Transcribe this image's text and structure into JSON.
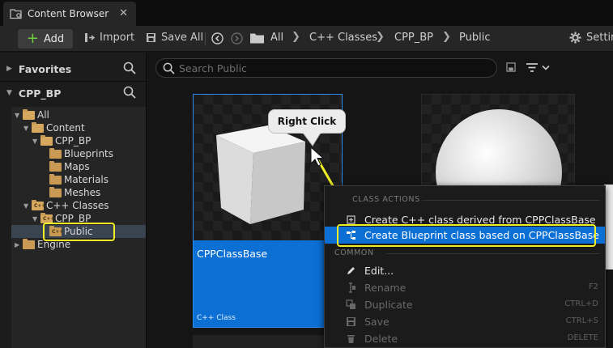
{
  "tab": {
    "title": "Content Browser",
    "close": "✕"
  },
  "toolbar": {
    "add_label": "Add",
    "add_plus": "+",
    "import_label": "Import",
    "save_all_label": "Save All",
    "settings_label": "Settings"
  },
  "breadcrumb": [
    "All",
    "C++ Classes",
    "CPP_BP",
    "Public"
  ],
  "left": {
    "favorites_label": "Favorites",
    "project_label": "CPP_BP",
    "tree": [
      {
        "label": "All",
        "depth": 0,
        "open": true,
        "cpp": false
      },
      {
        "label": "Content",
        "depth": 1,
        "open": true,
        "cpp": false
      },
      {
        "label": "CPP_BP",
        "depth": 2,
        "open": true,
        "cpp": false
      },
      {
        "label": "Blueprints",
        "depth": 3,
        "open": false,
        "cpp": false
      },
      {
        "label": "Maps",
        "depth": 3,
        "open": false,
        "cpp": false
      },
      {
        "label": "Materials",
        "depth": 3,
        "open": false,
        "cpp": false
      },
      {
        "label": "Meshes",
        "depth": 3,
        "open": false,
        "cpp": false
      },
      {
        "label": "C++ Classes",
        "depth": 1,
        "open": true,
        "cpp": true
      },
      {
        "label": "CPP_BP",
        "depth": 2,
        "open": true,
        "cpp": true
      },
      {
        "label": "Public",
        "depth": 3,
        "open": false,
        "cpp": true
      },
      {
        "label": "Engine",
        "depth": 0,
        "open": false,
        "cpp": false
      }
    ]
  },
  "search": {
    "placeholder": "Search Public"
  },
  "asset": {
    "name": "CPPClassBase",
    "type": "C++ Class"
  },
  "callout": {
    "text": "Right Click"
  },
  "menu": {
    "category_class_actions": "CLASS ACTIONS",
    "category_common": "COMMON",
    "items": [
      {
        "label": "Create C++ class derived from CPPClassBase",
        "shortcut": "",
        "enabled": true,
        "highlighted": false,
        "icon": "cpp-class-icon"
      },
      {
        "label": "Create Blueprint class based on CPPClassBase",
        "shortcut": "",
        "enabled": true,
        "highlighted": true,
        "icon": "blueprint-class-icon"
      },
      {
        "label": "Edit...",
        "shortcut": "",
        "enabled": true,
        "highlighted": false,
        "icon": "pencil-icon"
      },
      {
        "label": "Rename",
        "shortcut": "F2",
        "enabled": false,
        "highlighted": false,
        "icon": "rename-icon"
      },
      {
        "label": "Duplicate",
        "shortcut": "CTRL+D",
        "enabled": false,
        "highlighted": false,
        "icon": "duplicate-icon"
      },
      {
        "label": "Save",
        "shortcut": "CTRL+S",
        "enabled": false,
        "highlighted": false,
        "icon": "save-icon"
      },
      {
        "label": "Delete",
        "shortcut": "DELETE",
        "enabled": false,
        "highlighted": false,
        "icon": "trash-icon"
      }
    ]
  },
  "colors": {
    "accent_blue": "#0b6fd4",
    "annotation_yellow": "#f0ee26",
    "folder": "#c99a53",
    "add_plus_green": "#6fcf3a"
  }
}
